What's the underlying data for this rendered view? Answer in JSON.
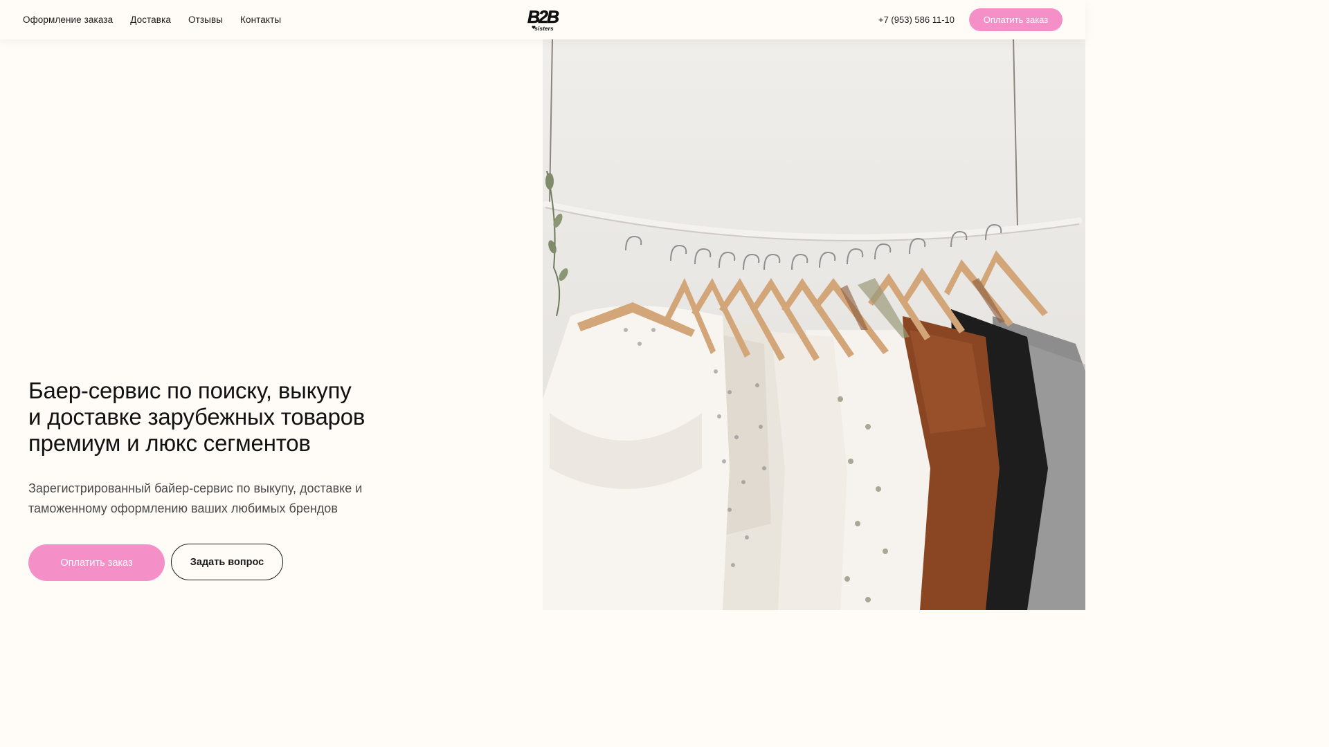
{
  "header": {
    "nav": [
      {
        "label": "Оформление заказа"
      },
      {
        "label": "Доставка"
      },
      {
        "label": "Отзывы"
      },
      {
        "label": "Контакты"
      }
    ],
    "logo": {
      "text": "B2B",
      "subtext": "sisters",
      "icon": "heart-icon"
    },
    "phone": "+7 (953) 586 11-10",
    "pay_label": "Оплатить заказ"
  },
  "hero": {
    "title_lines": [
      "Баер-сервис по поиску, выкупу",
      "и доставке зарубежных товаров",
      "премиум и люкс сегментов"
    ],
    "subtitle_lines": [
      "Зарегистрированный байер-сервис по выкупу, доставке и",
      "таможенному оформлению ваших любимых брендов"
    ],
    "pay_label": "Оплатить заказ",
    "ask_label": "Задать вопрос",
    "image": "clothes-rack-photo"
  },
  "colors": {
    "background": "#fffcf8",
    "accent_pink": "#f48fc7",
    "text": "#1a1a1a"
  }
}
